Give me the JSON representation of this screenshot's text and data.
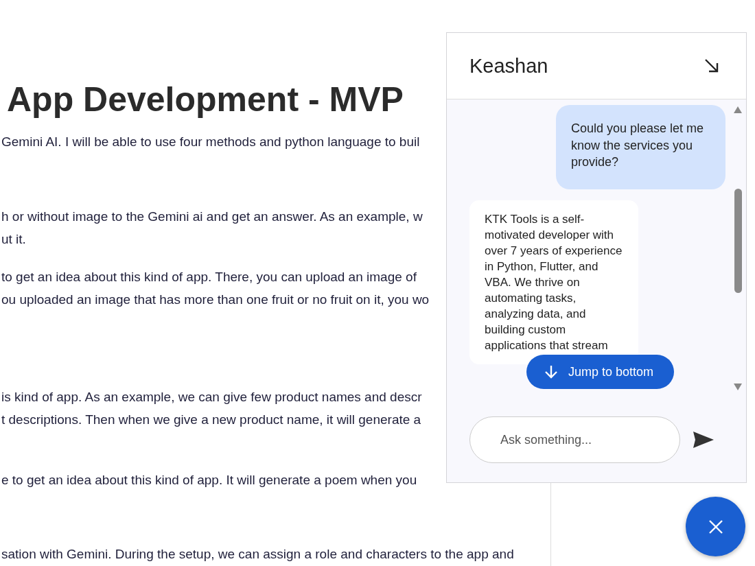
{
  "document": {
    "title": "App Development - MVP",
    "paragraphs": [
      {
        "lines": [
          "Gemini AI. I will be able to use four methods and python language to buil"
        ]
      },
      {
        "lines": [
          "h or without image to the Gemini ai and get an answer. As an example, w",
          "ut it."
        ]
      },
      {
        "lines": [
          "to get an idea about this kind of app. There, you can upload an image of",
          "ou uploaded an image that has more than one fruit or no fruit on it, you wo"
        ]
      },
      {
        "lines": [
          "is kind of app. As an example, we can give few product names and descr",
          "t descriptions. Then when we give a new product name, it will generate a"
        ]
      },
      {
        "lines": [
          "e to get an idea about this kind of app. It will generate a poem when you"
        ]
      },
      {
        "lines": [
          "sation with Gemini. During the setup, we can assign a role and characters to the app and"
        ]
      }
    ]
  },
  "chat": {
    "title": "Keashan",
    "messages": [
      {
        "kind": "user",
        "text": "Could you please let me know the services you provide?"
      },
      {
        "kind": "bot",
        "text": "KTK Tools is a self-motivated developer with over 7 years of experience in Python, Flutter, and VBA. We thrive on automating tasks, analyzing data, and building custom applications that stream"
      }
    ],
    "jump_button": "Jump to bottom",
    "input": {
      "placeholder": "Ask something..."
    }
  }
}
